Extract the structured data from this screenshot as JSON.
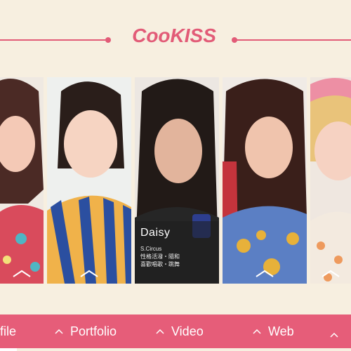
{
  "brand": {
    "logo_text": "CooKISS",
    "accent": "#e65d79",
    "background": "#f7efe0"
  },
  "members": [
    {
      "id": "m1",
      "shirt": "#d94b5c"
    },
    {
      "id": "m2",
      "shirt": "#2b4fa0"
    },
    {
      "id": "m3",
      "shirt": "#262626",
      "active": true,
      "name": "Daisy",
      "info_lines": [
        "S.Circus",
        "性格活潑・隨和",
        "喜歡唱歌・跳舞"
      ]
    },
    {
      "id": "m4",
      "shirt": "#e7b13a"
    },
    {
      "id": "m5",
      "shirt": "#f3eadf"
    }
  ],
  "nav": {
    "items": [
      {
        "label": "file",
        "active": true
      },
      {
        "label": "Portfolio"
      },
      {
        "label": "Video"
      },
      {
        "label": "Web"
      }
    ]
  }
}
